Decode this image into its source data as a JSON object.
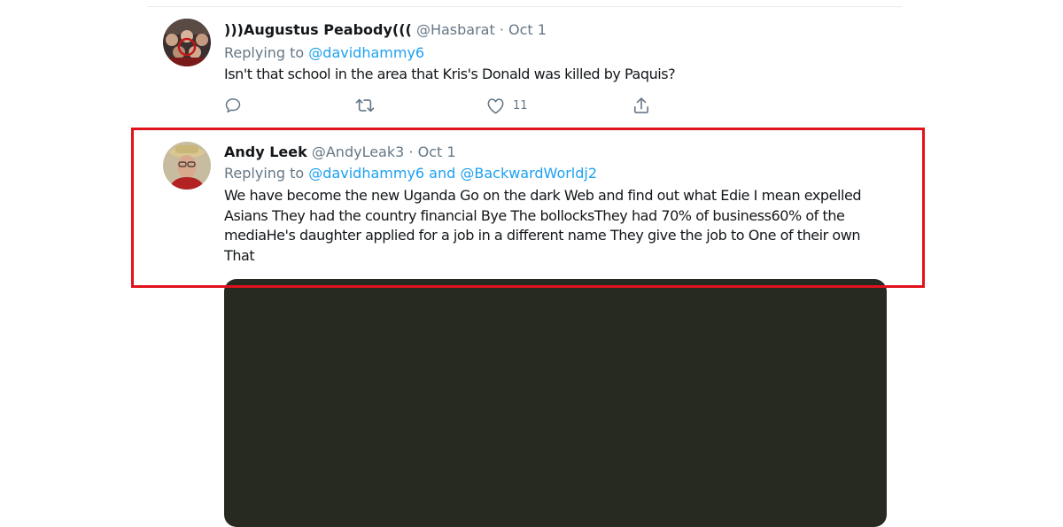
{
  "tweets": [
    {
      "name": ")))Augustus Peabody(((",
      "handle": "@Hasbarat",
      "separator": "·",
      "date": "Oct 1",
      "replying_prefix": "Replying to",
      "replying_to": "@davidhammy6",
      "text": "Isn't that school in the area that Kris's Donald was killed by Paquis?",
      "actions": {
        "reply_icon": "reply-icon",
        "retweet_icon": "retweet-icon",
        "like_icon": "heart-icon",
        "like_count": "11",
        "share_icon": "share-icon"
      }
    },
    {
      "name": "Andy Leek",
      "handle": "@AndyLeak3",
      "separator": "·",
      "date": "Oct 1",
      "replying_prefix": "Replying to",
      "replying_to": "@davidhammy6 and @BackwardWorldj2",
      "text_lines": [
        "We have become the new Uganda Go on the dark Web and find out what Edie I mean expelled",
        "Asians They had the country financial Bye The bollocksThey had 70% of business60% of the",
        "mediaHe's daughter applied for a job in a different name They give the job to  One of their own",
        "That"
      ]
    }
  ],
  "colors": {
    "link": "#1da1f2",
    "muted": "#657786",
    "highlight": "#e0121c",
    "media_bg": "#262a21"
  }
}
